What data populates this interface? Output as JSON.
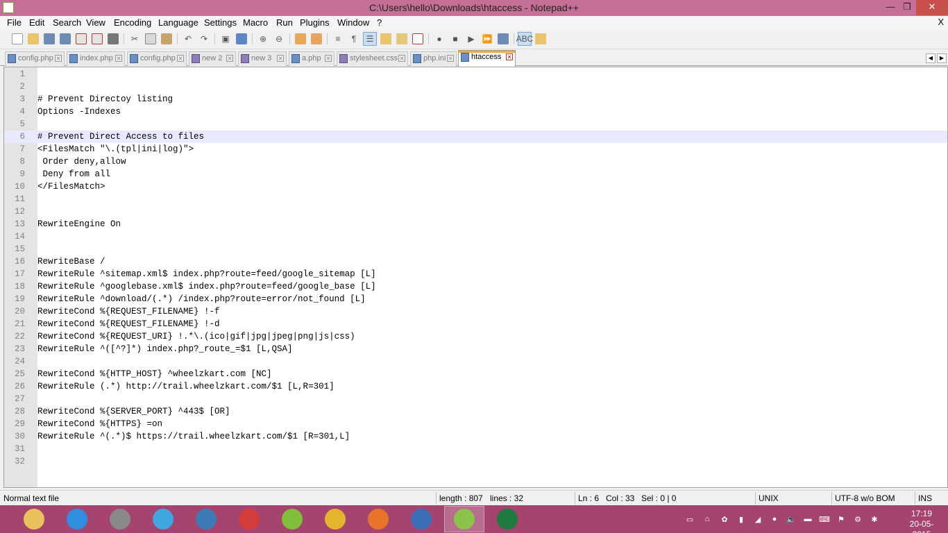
{
  "window": {
    "title": "C:\\Users\\hello\\Downloads\\htaccess - Notepad++",
    "minimize": "—",
    "restore": "❐",
    "close": "✕"
  },
  "menu": {
    "items": [
      "File",
      "Edit",
      "Search",
      "View",
      "Encoding",
      "Language",
      "Settings",
      "Macro",
      "Run",
      "Plugins",
      "Window",
      "?"
    ],
    "close": "X"
  },
  "tabs": [
    {
      "label": "config.php",
      "active": false
    },
    {
      "label": "index.php",
      "active": false
    },
    {
      "label": "config.php",
      "active": false
    },
    {
      "label": "new 2",
      "active": false
    },
    {
      "label": "new 3",
      "active": false
    },
    {
      "label": "a.php",
      "active": false
    },
    {
      "label": "stylesheet.css",
      "active": false
    },
    {
      "label": "php.ini",
      "active": false
    },
    {
      "label": "htaccess",
      "active": true
    }
  ],
  "editor": {
    "current_line": 6,
    "lines": [
      "",
      "",
      "# Prevent Directoy listing",
      "Options -Indexes",
      "",
      "# Prevent Direct Access to files",
      "<FilesMatch \"\\.(tpl|ini|log)\">",
      " Order deny,allow",
      " Deny from all",
      "</FilesMatch>",
      "",
      "",
      "RewriteEngine On",
      "",
      "",
      "RewriteBase /",
      "RewriteRule ^sitemap.xml$ index.php?route=feed/google_sitemap [L]",
      "RewriteRule ^googlebase.xml$ index.php?route=feed/google_base [L]",
      "RewriteRule ^download/(.*) /index.php?route=error/not_found [L]",
      "RewriteCond %{REQUEST_FILENAME} !-f",
      "RewriteCond %{REQUEST_FILENAME} !-d",
      "RewriteCond %{REQUEST_URI} !.*\\.(ico|gif|jpg|jpeg|png|js|css)",
      "RewriteRule ^([^?]*) index.php?_route_=$1 [L,QSA]",
      "",
      "RewriteCond %{HTTP_HOST} ^wheelzkart.com [NC]",
      "RewriteRule (.*) http://trail.wheelzkart.com/$1 [L,R=301]",
      "",
      "RewriteCond %{SERVER_PORT} ^443$ [OR]",
      "RewriteCond %{HTTPS} =on",
      "RewriteRule ^(.*)$ https://trail.wheelzkart.com/$1 [R=301,L]",
      "",
      ""
    ]
  },
  "status": {
    "file_type": "Normal text file",
    "length": "length : 807",
    "lines": "lines : 32",
    "ln": "Ln : 6",
    "col": "Col : 33",
    "sel": "Sel : 0 | 0",
    "eol": "UNIX",
    "encoding": "UTF-8 w/o BOM",
    "mode": "INS"
  },
  "taskbar": {
    "apps": [
      {
        "name": "file-explorer-icon",
        "color": "#e8c25a"
      },
      {
        "name": "internet-explorer-icon",
        "color": "#2f8ee0"
      },
      {
        "name": "disk-utility-icon",
        "color": "#8a8a8a"
      },
      {
        "name": "media-disc-icon",
        "color": "#3fa6df"
      },
      {
        "name": "video-player-icon",
        "color": "#3c7bb5"
      },
      {
        "name": "audio-editor-icon",
        "color": "#d43c3c"
      },
      {
        "name": "music-player-icon",
        "color": "#7fbf3a"
      },
      {
        "name": "chrome-icon",
        "color": "#e2b52d"
      },
      {
        "name": "firefox-icon",
        "color": "#e8742a"
      },
      {
        "name": "thunderbird-icon",
        "color": "#3a6fb7"
      },
      {
        "name": "notepad-plus-plus-icon",
        "color": "#8bc34a"
      },
      {
        "name": "excel-icon",
        "color": "#1f7a3e"
      }
    ],
    "time": "17:19",
    "date": "20-05-2015"
  }
}
